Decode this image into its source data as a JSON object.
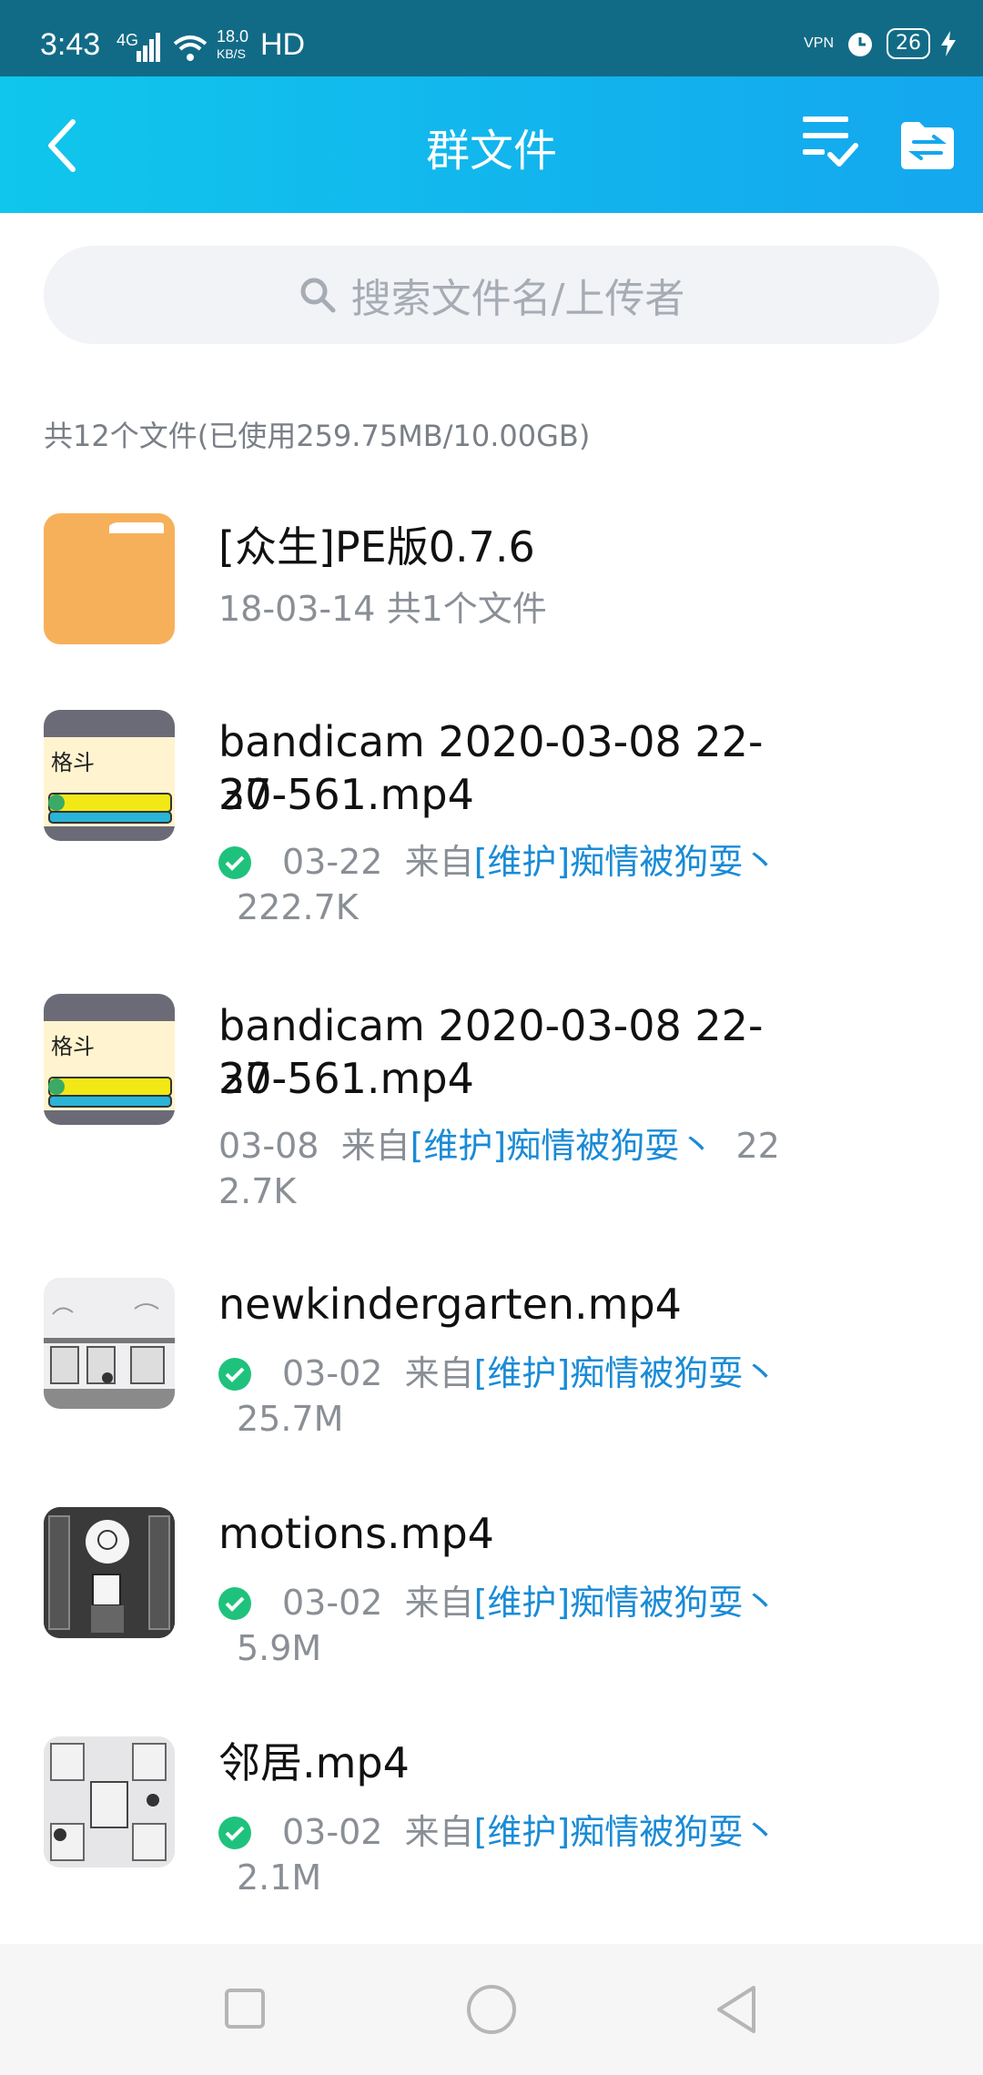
{
  "status_bar": {
    "time": "3:43",
    "network": "4G",
    "speed_value": "18.0",
    "speed_unit": "KB/S",
    "hd": "HD",
    "vpn": "VPN",
    "battery": "26"
  },
  "header": {
    "title": "群文件"
  },
  "search": {
    "placeholder": "搜索文件名/上传者"
  },
  "summary": "共12个文件(已使用259.75MB/10.00GB)",
  "files": [
    {
      "name": "[众生]PE版0.7.6",
      "type": "folder",
      "meta": "18-03-14  共1个文件"
    },
    {
      "name_line1": "bandicam 2020-03-08 22-37-",
      "name_line2": "20-561.mp4",
      "date": "03-22",
      "from": "来自",
      "uploader": "[维护]痴情被狗耍丶",
      "size": "222.7K",
      "downloaded": true
    },
    {
      "name_line1": "bandicam 2020-03-08 22-37-",
      "name_line2": "20-561.mp4",
      "date": "03-08",
      "from": "来自",
      "uploader": "[维护]痴情被狗耍丶",
      "size_part1": "22",
      "size_part2": "2.7K",
      "downloaded": false
    },
    {
      "name": "newkindergarten.mp4",
      "date": "03-02",
      "from": "来自",
      "uploader": "[维护]痴情被狗耍丶",
      "size": "25.7M",
      "downloaded": true
    },
    {
      "name": "motions.mp4",
      "date": "03-02",
      "from": "来自",
      "uploader": "[维护]痴情被狗耍丶",
      "size": "5.9M",
      "downloaded": true
    },
    {
      "name": "邻居.mp4",
      "date": "03-02",
      "from": "来自",
      "uploader": "[维护]痴情被狗耍丶",
      "size": "2.1M",
      "downloaded": true
    }
  ],
  "thumb_text": "格斗",
  "colors": {
    "header_start": "#10c6ec",
    "header_end": "#14a7ee",
    "status_bar": "#126b86",
    "folder": "#f7b05a",
    "downloaded_check": "#1fc27c",
    "uploader_link": "#1a8bd6"
  }
}
